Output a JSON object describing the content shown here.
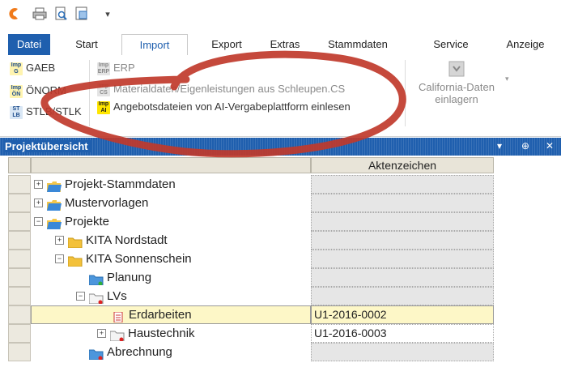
{
  "qat": {
    "icons": [
      "app-logo-icon",
      "printer-icon",
      "print-preview-icon",
      "page-setup-icon",
      "customize-dropdown-icon"
    ],
    "dropdown_glyph": "▾"
  },
  "tabs": [
    {
      "label": "Datei",
      "state": "file"
    },
    {
      "label": "Start",
      "state": "normal"
    },
    {
      "label": "Import",
      "state": "active"
    },
    {
      "label": "Export",
      "state": "normal"
    },
    {
      "label": "Extras",
      "state": "normal"
    },
    {
      "label": "Stammdaten",
      "state": "normal"
    },
    {
      "label": "Service",
      "state": "normal"
    },
    {
      "label": "Anzeige",
      "state": "normal"
    }
  ],
  "ribbon": {
    "col1": [
      {
        "label": "GAEB",
        "icon_text": "Imp G",
        "enabled": true
      },
      {
        "label": "ÖNORM",
        "icon_text": "Imp ÖN",
        "enabled": true
      },
      {
        "label": "STLB/STLK",
        "icon_text": "ST LB",
        "enabled": true
      }
    ],
    "col2": [
      {
        "label": "ERP",
        "icon_text": "Imp ERP",
        "enabled": false
      },
      {
        "label": "Materialdaten/Eigenleistungen aus Schleupen.CS",
        "icon_text": "Imp CS",
        "enabled": false
      },
      {
        "label": "Angebotsdateien von AI-Vergabeplattform einlesen",
        "icon_text": "Imp AI",
        "enabled": true
      }
    ],
    "california": {
      "line1": "California-Daten",
      "line2": "einlagern",
      "enabled": false
    }
  },
  "panel": {
    "title": "Projektübersicht",
    "pin_glyph": "⊕",
    "close_glyph": "✕",
    "menu_glyph": "▾"
  },
  "grid": {
    "column_header": "Aktenzeichen",
    "rows": [
      {
        "label": "Projekt-Stammdaten",
        "level": 0,
        "expander": "+",
        "folder": "blue",
        "value": ""
      },
      {
        "label": "Mustervorlagen",
        "level": 0,
        "expander": "+",
        "folder": "blue",
        "value": ""
      },
      {
        "label": "Projekte",
        "level": 0,
        "expander": "−",
        "folder": "blue",
        "value": ""
      },
      {
        "label": "KITA Nordstadt",
        "level": 1,
        "expander": "+",
        "folder": "yellow",
        "value": ""
      },
      {
        "label": "KITA Sonnenschein",
        "level": 1,
        "expander": "−",
        "folder": "yellow",
        "value": ""
      },
      {
        "label": "Planung",
        "level": 2,
        "expander": "",
        "folder": "blue-green",
        "value": ""
      },
      {
        "label": "LVs",
        "level": 2,
        "expander": "−",
        "folder": "white-red",
        "value": ""
      },
      {
        "label": "Erdarbeiten",
        "level": 3,
        "expander": "",
        "folder": "doc",
        "value": "U1-2016-0002",
        "highlight": true
      },
      {
        "label": "Haustechnik",
        "level": 3,
        "expander": "+",
        "folder": "white-red",
        "value": "U1-2016-0003",
        "white": true
      },
      {
        "label": "Abrechnung",
        "level": 2,
        "expander": "",
        "folder": "blue-red",
        "value": ""
      }
    ]
  },
  "annotation_color": "#c0392b"
}
